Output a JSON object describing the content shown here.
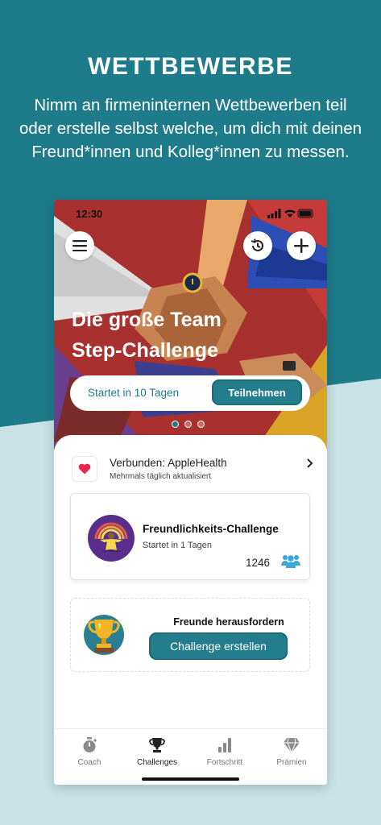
{
  "promo": {
    "title": "WETTBEWERBE",
    "subtitle": "Nimm an firmeninternen Wettbewerben teil oder erstelle selbst welche, um dich mit deinen Freund*innen und Kolleg*innen zu messen."
  },
  "status_bar": {
    "time": "12:30"
  },
  "hero": {
    "title_line1": "Die große Team",
    "title_line2": "Step-Challenge",
    "start_text": "Startet in 10 Tagen",
    "join_label": "Teilnehmen",
    "page_count": 3,
    "active_page": 1
  },
  "health": {
    "title": "Verbunden: AppleHealth",
    "subtitle": "Mehrmals täglich aktualisiert"
  },
  "challenge": {
    "title": "Freundlichkeits-Challenge",
    "start_text": "Startet in 1 Tagen",
    "participants": "1246"
  },
  "invite": {
    "title": "Freunde herausfordern",
    "button_label": "Challenge erstellen"
  },
  "tabs": [
    {
      "label": "Coach",
      "icon": "stopwatch-icon"
    },
    {
      "label": "Challenges",
      "icon": "trophy-icon"
    },
    {
      "label": "Fortschritt",
      "icon": "bar-chart-icon"
    },
    {
      "label": "Prämien",
      "icon": "diamond-icon"
    }
  ],
  "active_tab": "Challenges",
  "colors": {
    "teal": "#1e7b8a",
    "background_light": "#c8e2e6",
    "heart": "#e8274b",
    "people_icon": "#3aa7d9"
  }
}
